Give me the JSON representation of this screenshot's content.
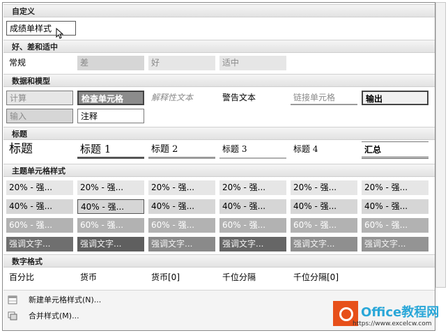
{
  "sections": {
    "custom": "自定义",
    "good_bad": "好、差和适中",
    "data_model": "数据和模型",
    "titles": "标题",
    "theme": "主题单元格样式",
    "number": "数字格式"
  },
  "custom_styles": [
    "成绩单样式"
  ],
  "good_bad_styles": [
    "常规",
    "差",
    "好",
    "适中"
  ],
  "data_model_styles": {
    "row1": [
      "计算",
      "检查单元格",
      "解释性文本",
      "警告文本",
      "链接单元格",
      "输出"
    ],
    "row2": [
      "输入",
      "注释"
    ]
  },
  "title_styles": [
    "标题",
    "标题 1",
    "标题 2",
    "标题 3",
    "标题 4",
    "汇总"
  ],
  "theme_styles": {
    "row20": [
      "20% - 强...",
      "20% - 强...",
      "20% - 强...",
      "20% - 强...",
      "20% - 强...",
      "20% - 强..."
    ],
    "row40": [
      "40% - 强...",
      "40% - 强...",
      "40% - 强...",
      "40% - 强...",
      "40% - 强...",
      "40% - 强..."
    ],
    "row60": [
      "60% - 强...",
      "60% - 强...",
      "60% - 强...",
      "60% - 强...",
      "60% - 强...",
      "60% - 强..."
    ],
    "accent": [
      "强调文字...",
      "强调文字...",
      "强调文字...",
      "强调文字...",
      "强调文字...",
      "强调文字..."
    ]
  },
  "number_styles": [
    "百分比",
    "货币",
    "货币[0]",
    "千位分隔",
    "千位分隔[0]"
  ],
  "menu": {
    "new_style": "新建单元格样式(N)...",
    "merge_styles": "合并样式(M)..."
  },
  "watermark": {
    "title": "Office教程网",
    "url": "https://www.excelcw.com"
  },
  "colors": {
    "accent_orange": "#e7501a",
    "accent_blue": "#2aa7d8"
  }
}
